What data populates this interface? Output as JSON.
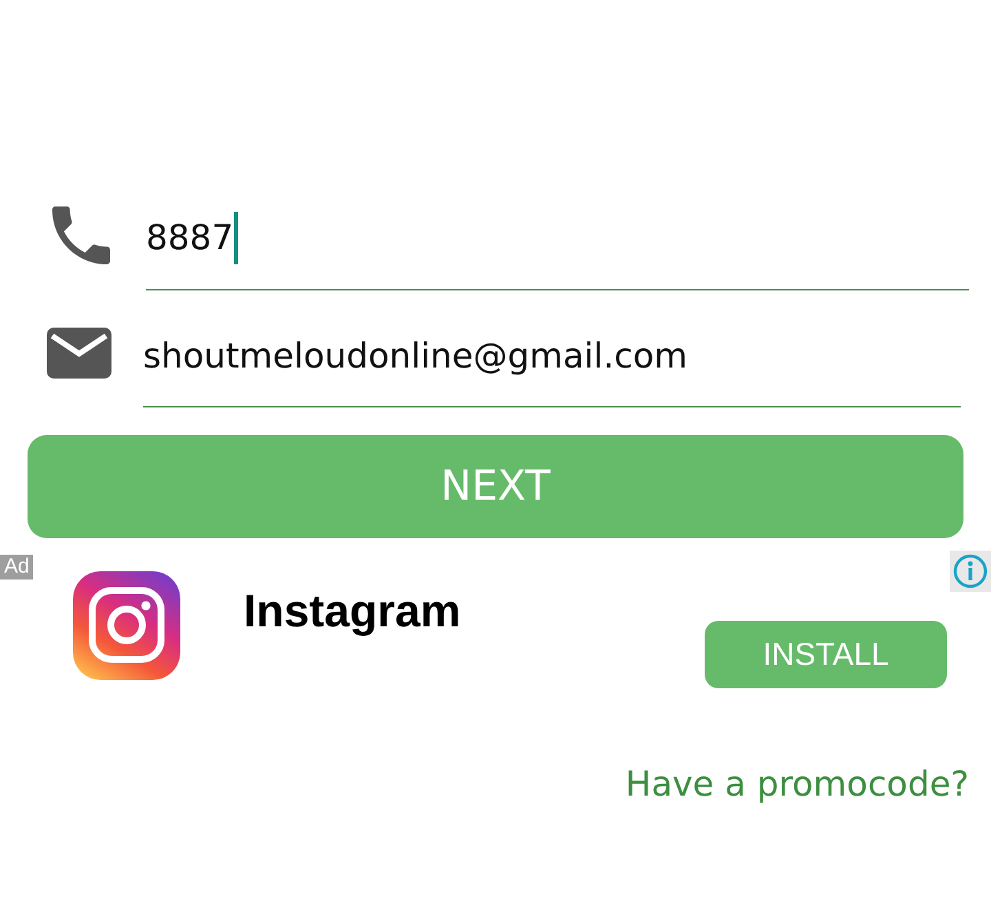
{
  "form": {
    "fields": [
      {
        "kind": "phone",
        "value": "8887",
        "focused": true
      },
      {
        "kind": "email",
        "value": "shoutmeloudonline@gmail.com",
        "focused": false
      }
    ],
    "next_button": "NEXT"
  },
  "ad": {
    "badge": "Ad",
    "app_name": "Instagram",
    "install_button": "INSTALL"
  },
  "promo_link": "Have a promocode?"
}
